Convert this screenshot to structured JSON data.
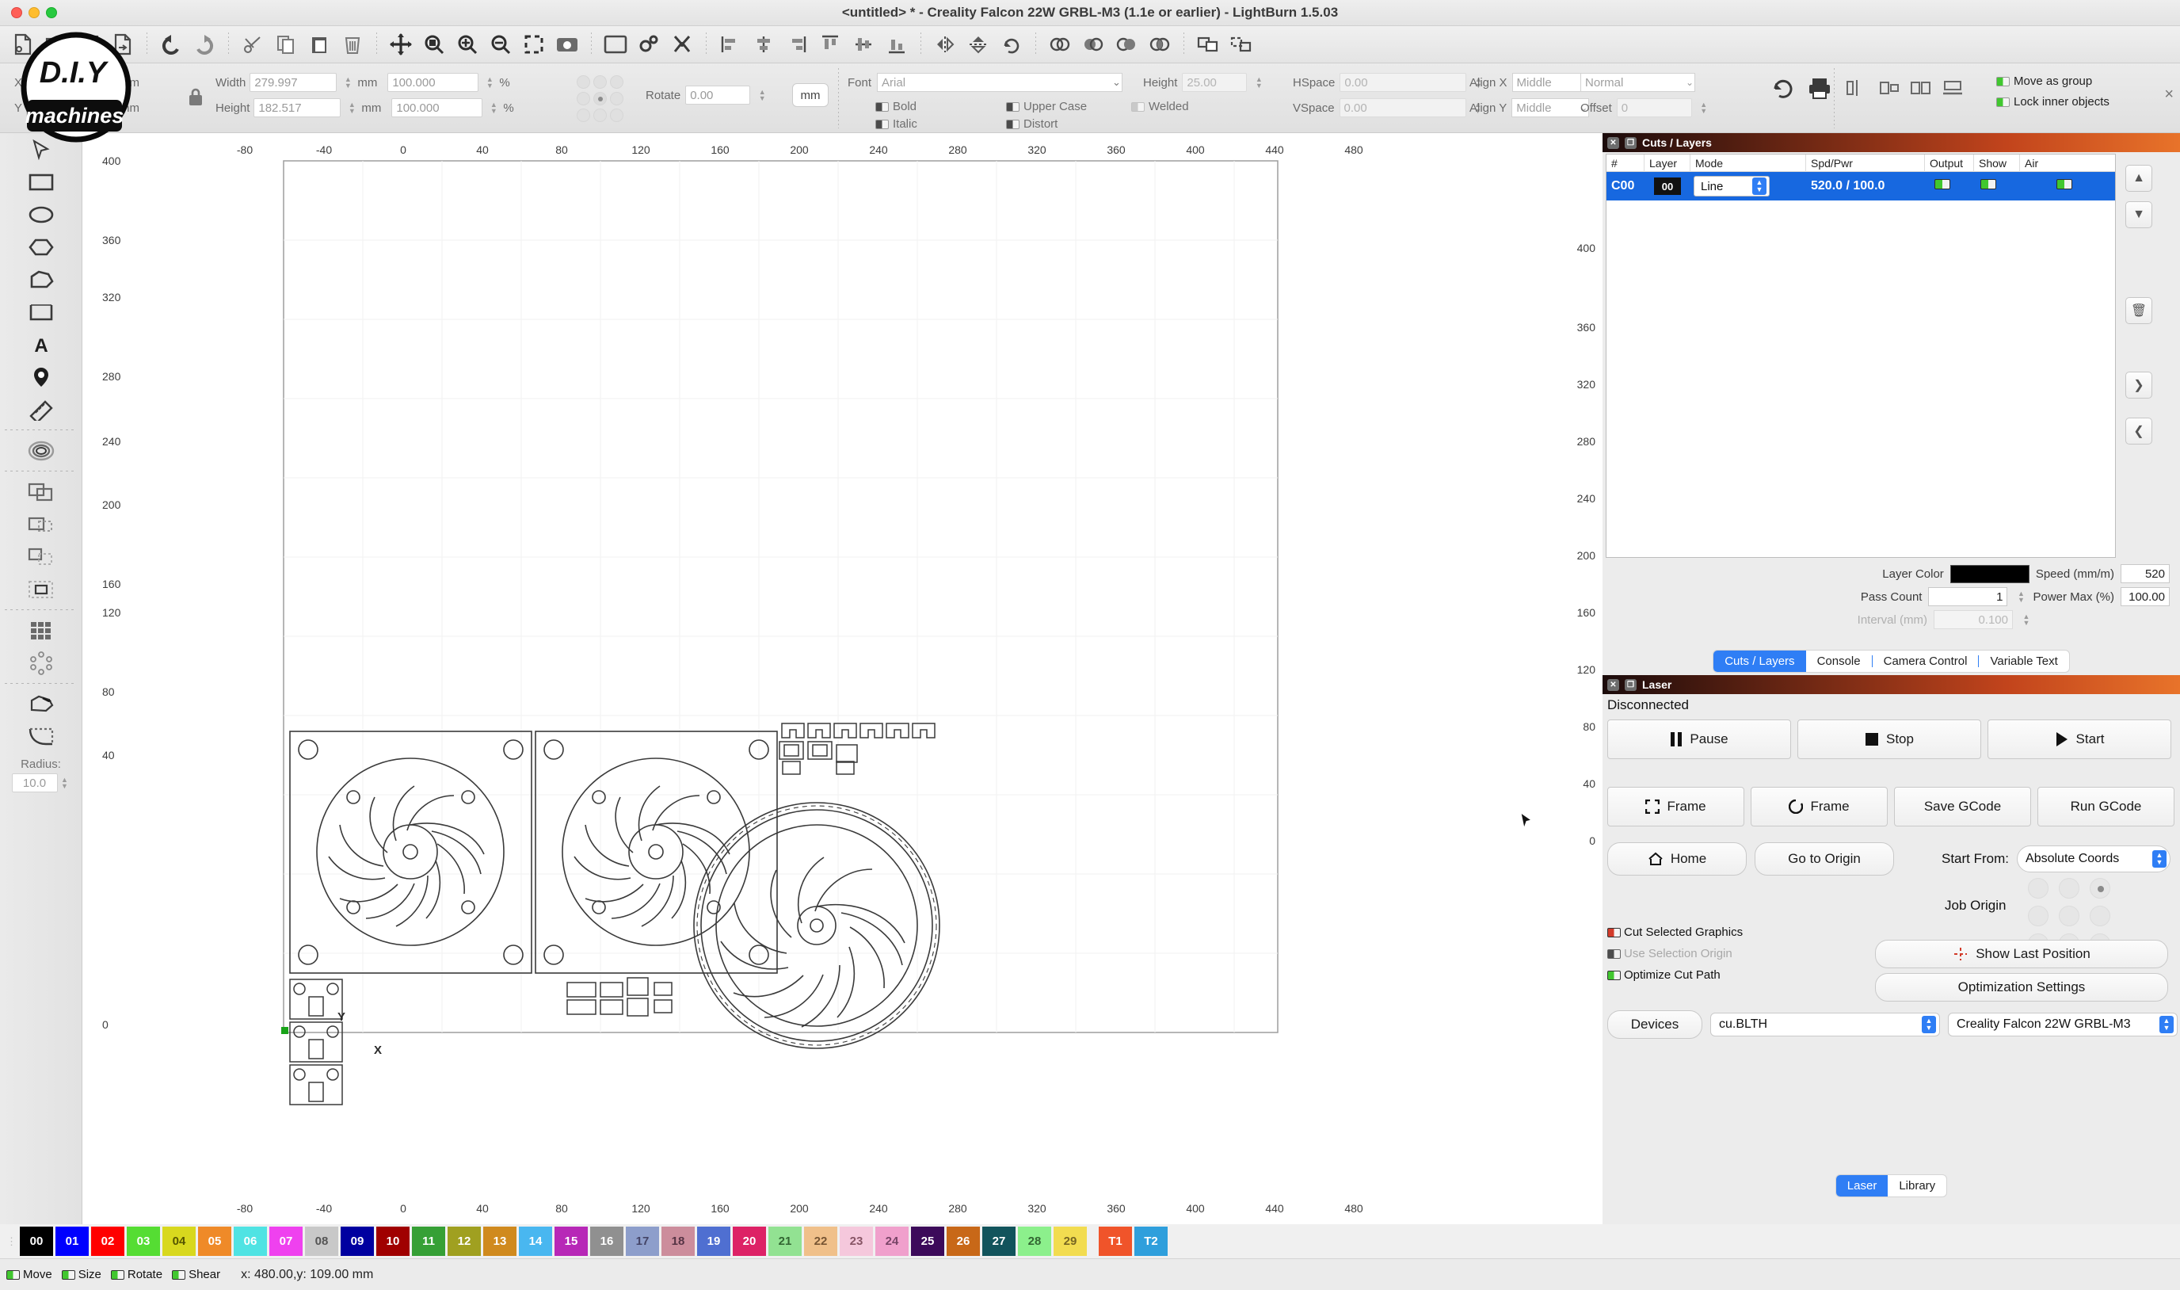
{
  "window": {
    "title": "<untitled> * - Creality Falcon 22W GRBL-M3 (1.1e or earlier) - LightBurn 1.5.03"
  },
  "toolbar": {
    "groups": [
      [
        "new-file-icon",
        "open-file-icon",
        "save-file-icon",
        "export-file-icon"
      ],
      [
        "undo-icon",
        "redo-icon"
      ],
      [
        "cut-icon",
        "copy-icon",
        "paste-icon",
        "delete-icon"
      ],
      [
        "move-icon",
        "zoom-fit-icon",
        "zoom-in-icon",
        "zoom-out-icon",
        "frame-select-icon",
        "camera-icon"
      ],
      [
        "page-icon",
        "settings-icon",
        "device-settings-icon"
      ],
      [
        "align-left-icon",
        "align-center-h-icon",
        "align-right-icon",
        "align-top-icon",
        "align-middle-icon",
        "align-bottom-icon"
      ],
      [
        "mirror-h-icon",
        "mirror-v-icon",
        "rotate-90-icon"
      ],
      [
        "weld-icon",
        "boolean-union-icon",
        "boolean-subtract-icon",
        "boolean-intersect-icon"
      ],
      [
        "group-icon",
        "ungroup-icon"
      ]
    ]
  },
  "properties": {
    "xlabel": "X",
    "ylabel": "Y",
    "x_value": "",
    "y_value": "",
    "unit_mm": "mm",
    "width_label": "Width",
    "width_value": "279.997",
    "height_label": "Height",
    "height_value": "182.517",
    "scale_w_value": "100.000",
    "scale_h_value": "100.000",
    "percent": "%",
    "rotate_label": "Rotate",
    "rotate_value": "0.00",
    "unit_button": "mm",
    "font_label": "Font",
    "font_value": "Arial",
    "bold_label": "Bold",
    "italic_label": "Italic",
    "uppercase_label": "Upper Case",
    "distort_label": "Distort",
    "welded_label": "Welded",
    "text_height_label": "Height",
    "text_height_value": "25.00",
    "hspace_label": "HSpace",
    "hspace_value": "0.00",
    "vspace_label": "VSpace",
    "vspace_value": "0.00",
    "alignx_label": "Align X",
    "alignx_value": "Middle",
    "aligny_label": "Align Y",
    "aligny_value": "Middle",
    "style_value": "Normal",
    "offset_label": "Offset",
    "offset_value": "0",
    "move_as_group": "Move as group",
    "lock_inner_objects": "Lock inner objects"
  },
  "tools": {
    "items": [
      "select-tool",
      "rectangle-tool",
      "ellipse-tool",
      "polygon-tool",
      "draw-lines-tool",
      "closed-shape-tool",
      "text-tool",
      "point-tool",
      "measure-tool",
      "offset-shapes-tool",
      "boolean-union-tool",
      "boolean-subtract-tool",
      "boolean-intersect-tool",
      "boolean-cut-tool",
      "grid-array-tool",
      "circular-array-tool",
      "edit-nodes-tool",
      "fillet-tool"
    ],
    "radius_label": "Radius:",
    "radius_value": "10.0"
  },
  "canvas": {
    "ruler_top_ticks": [
      "-80",
      "-40",
      "0",
      "40",
      "80",
      "120",
      "160",
      "200",
      "240",
      "280",
      "320",
      "360",
      "400",
      "440",
      "480"
    ],
    "ruler_left_ticks": [
      "400",
      "360",
      "320",
      "280",
      "240",
      "200",
      "160",
      "120",
      "80",
      "40",
      "0"
    ],
    "ruler_right_ticks": [
      "400",
      "360",
      "320",
      "280",
      "240",
      "200",
      "160",
      "120",
      "80",
      "40",
      "0"
    ],
    "ruler_bottom_ticks": [
      "-80",
      "-40",
      "0",
      "40",
      "80",
      "120",
      "160",
      "200",
      "240",
      "280",
      "320",
      "360",
      "400",
      "440",
      "480"
    ],
    "origin_x_label": "X",
    "origin_y_label": "Y"
  },
  "cuts_panel": {
    "title": "Cuts / Layers",
    "columns": [
      "#",
      "Layer",
      "Mode",
      "Spd/Pwr",
      "Output",
      "Show",
      "Air"
    ],
    "rows": [
      {
        "num": "C00",
        "layer": "00",
        "mode": "Line",
        "spd_pwr": "520.0 / 100.0",
        "output": true,
        "show": true,
        "air": true
      }
    ],
    "settings": {
      "layer_color_label": "Layer Color",
      "layer_color": "#000000",
      "pass_count_label": "Pass Count",
      "pass_count": "1",
      "interval_label": "Interval (mm)",
      "interval": "0.100",
      "speed_label": "Speed (mm/m)",
      "speed": "520",
      "power_label": "Power Max (%)",
      "power": "100.00"
    },
    "side_buttons": [
      "move-layer-up-icon",
      "move-layer-down-icon",
      "delete-layer-icon",
      "next-icon",
      "prev-icon"
    ]
  },
  "dock_tabs": {
    "items": [
      "Cuts / Layers",
      "Console",
      "Camera Control",
      "Variable Text"
    ],
    "active": "Cuts / Layers"
  },
  "laser_panel": {
    "title": "Laser",
    "status": "Disconnected",
    "pause": "Pause",
    "stop": "Stop",
    "start": "Start",
    "frame_square": "Frame",
    "frame_round": "Frame",
    "save_gcode": "Save GCode",
    "run_gcode": "Run GCode",
    "home": "Home",
    "go_to_origin": "Go to Origin",
    "start_from_label": "Start From:",
    "start_from_value": "Absolute Coords",
    "job_origin_label": "Job Origin",
    "job_origin_selected": "top-right",
    "cut_selected_graphics": "Cut Selected Graphics",
    "use_selection_origin": "Use Selection Origin",
    "optimize_cut_path": "Optimize Cut Path",
    "show_last_position": "Show Last Position",
    "optimization_settings": "Optimization Settings",
    "devices_label": "Devices",
    "port_value": "cu.BLTH",
    "device_value": "Creality Falcon 22W GRBL-M3"
  },
  "bottom_tabs": {
    "items": [
      "Laser",
      "Library"
    ],
    "active": "Laser"
  },
  "palette": {
    "swatches": [
      {
        "label": "00",
        "color": "#000000",
        "fg": "#ffffff"
      },
      {
        "label": "01",
        "color": "#0000ff",
        "fg": "#ffffff"
      },
      {
        "label": "02",
        "color": "#ff0000",
        "fg": "#ffffff"
      },
      {
        "label": "03",
        "color": "#55dd33",
        "fg": "#ffffff"
      },
      {
        "label": "04",
        "color": "#d8d81e",
        "fg": "#555500"
      },
      {
        "label": "05",
        "color": "#ef8a28",
        "fg": "#ffffff"
      },
      {
        "label": "06",
        "color": "#4fe3e3",
        "fg": "#ffffff"
      },
      {
        "label": "07",
        "color": "#ef41ef",
        "fg": "#ffffff"
      },
      {
        "label": "08",
        "color": "#c8c8c8",
        "fg": "#555555"
      },
      {
        "label": "09",
        "color": "#0000a0",
        "fg": "#ffffff"
      },
      {
        "label": "10",
        "color": "#a00000",
        "fg": "#ffffff"
      },
      {
        "label": "11",
        "color": "#36a036",
        "fg": "#ffffff"
      },
      {
        "label": "12",
        "color": "#a0a020",
        "fg": "#ffffff"
      },
      {
        "label": "13",
        "color": "#d08a1e",
        "fg": "#ffffff"
      },
      {
        "label": "14",
        "color": "#49b7f0",
        "fg": "#ffffff"
      },
      {
        "label": "15",
        "color": "#b728b7",
        "fg": "#ffffff"
      },
      {
        "label": "16",
        "color": "#909090",
        "fg": "#ffffff"
      },
      {
        "label": "17",
        "color": "#8d9ecb",
        "fg": "#444466"
      },
      {
        "label": "18",
        "color": "#cc8d9c",
        "fg": "#553344"
      },
      {
        "label": "19",
        "color": "#4f6fd1",
        "fg": "#ffffff"
      },
      {
        "label": "20",
        "color": "#dd2266",
        "fg": "#ffffff"
      },
      {
        "label": "21",
        "color": "#92e292",
        "fg": "#336633"
      },
      {
        "label": "22",
        "color": "#f0c08a",
        "fg": "#775533"
      },
      {
        "label": "23",
        "color": "#f5c8dc",
        "fg": "#885566"
      },
      {
        "label": "24",
        "color": "#f0a0cc",
        "fg": "#774466"
      },
      {
        "label": "25",
        "color": "#3c0a5a",
        "fg": "#ffffff"
      },
      {
        "label": "26",
        "color": "#c86818",
        "fg": "#ffffff"
      },
      {
        "label": "27",
        "color": "#12545c",
        "fg": "#ffffff"
      },
      {
        "label": "28",
        "color": "#8cf08c",
        "fg": "#336633"
      },
      {
        "label": "29",
        "color": "#f2dc50",
        "fg": "#776622"
      },
      {
        "label": "T1",
        "color": "#f0542a",
        "fg": "#ffffff"
      },
      {
        "label": "T2",
        "color": "#2f9fdc",
        "fg": "#ffffff"
      }
    ]
  },
  "status": {
    "move": "Move",
    "size": "Size",
    "rotate": "Rotate",
    "shear": "Shear",
    "coords": "x: 480.00,y: 109.00 mm"
  },
  "logo": {
    "line1": "D.I.Y",
    "line2": "machines"
  }
}
